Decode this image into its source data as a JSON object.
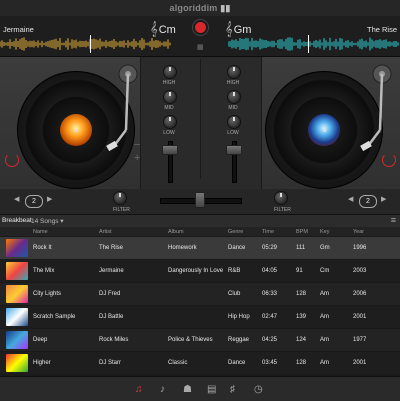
{
  "app": {
    "logo": "algoriddim"
  },
  "deck_left": {
    "track_title": "Jermaine",
    "key": "Cm",
    "key_icon": "treble-clef-icon",
    "pitch_value": "2"
  },
  "deck_right": {
    "track_title": "The Rise",
    "key": "Gm",
    "key_icon": "treble-clef-icon",
    "pitch_value": "2"
  },
  "mixer": {
    "eq_labels": [
      "HIGH",
      "MID",
      "LOW"
    ],
    "filter_label": "FILTER",
    "record_color": "#d8282c"
  },
  "library": {
    "title": "Breakbeat",
    "count": "14 Songs",
    "columns": [
      "Name",
      "Artist",
      "Album",
      "Genre",
      "Time",
      "BPM",
      "Key",
      "Year"
    ],
    "rows": [
      {
        "name": "Rock It",
        "artist": "The Rise",
        "album": "Homework",
        "genre": "Dance",
        "time": "05:29",
        "bpm": "111",
        "key": "Gm",
        "year": "1996",
        "selected": true
      },
      {
        "name": "The Mix",
        "artist": "Jermaine",
        "album": "Dangerously In Love",
        "genre": "R&B",
        "time": "04:05",
        "bpm": "91",
        "key": "Cm",
        "year": "2003",
        "selected": false
      },
      {
        "name": "City Lights",
        "artist": "DJ Fred",
        "album": "",
        "genre": "Club",
        "time": "06:33",
        "bpm": "128",
        "key": "Am",
        "year": "2006",
        "selected": false
      },
      {
        "name": "Scratch Sample",
        "artist": "DJ Battle",
        "album": "",
        "genre": "Hip Hop",
        "time": "02:47",
        "bpm": "139",
        "key": "Am",
        "year": "2001",
        "selected": false
      },
      {
        "name": "Deep",
        "artist": "Rock Miles",
        "album": "Police & Thieves",
        "genre": "Reggae",
        "time": "04:25",
        "bpm": "124",
        "key": "Am",
        "year": "1977",
        "selected": false
      },
      {
        "name": "Higher",
        "artist": "DJ Starr",
        "album": "Classic",
        "genre": "Dance",
        "time": "03:45",
        "bpm": "128",
        "key": "Am",
        "year": "2001",
        "selected": false
      }
    ]
  },
  "footer": {
    "icons": [
      "music-library-icon",
      "songs-icon",
      "artists-icon",
      "playlists-icon",
      "equalizer-icon",
      "history-icon"
    ]
  },
  "colors": {
    "accent": "#d8282c",
    "wave_left": "#e8b23a",
    "wave_right": "#2fd0d6"
  }
}
